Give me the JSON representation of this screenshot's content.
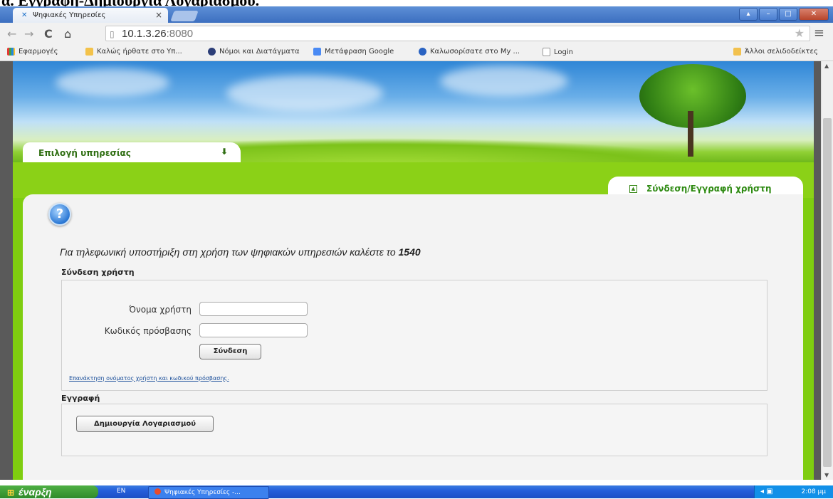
{
  "doc_heading": "α. Εγγραφή-Δημιουργία Λογαριασμού.",
  "browser": {
    "tab_title": "Ψηφιακές Υπηρεσίες",
    "tab_close": "×",
    "url_host": "10.1.3.26",
    "url_port": ":8080"
  },
  "bookmarks": {
    "items": [
      "Εφαρμογές",
      "Καλώς ήρθατε στο Υπ...",
      "Νόμοι και Διατάγματα",
      "Μετάφραση Google",
      "Καλωσορίσατε στο My ...",
      "Login"
    ],
    "other": "Άλλοι σελιδοδείκτες"
  },
  "site": {
    "service_tab": "Επιλογή υπηρεσίας",
    "login_tab": "Σύνδεση/Εγγραφή χρήστη",
    "support_text": "Για τηλεφωνική υποστήριξη στη χρήση των ψηφιακών υπηρεσιών καλέστε το",
    "support_number": "1540",
    "login_section": "Σύνδεση χρήστη",
    "username_label": "Όνομα χρήστη",
    "password_label": "Κωδικός πρόσβασης",
    "username_value": "",
    "password_value": "",
    "login_button": "Σύνδεση",
    "recover_link": "Επανάκτηση ονόματος χρήστη και κωδικού πρόσβασης.",
    "register_section": "Εγγραφή",
    "create_account_button": "Δημιουργία Λογαριασμού"
  },
  "taskbar": {
    "start": "έναρξη",
    "lang": "EN",
    "task": "Ψηφιακές Υπηρεσίες -...",
    "clock": "2:08 μμ"
  }
}
